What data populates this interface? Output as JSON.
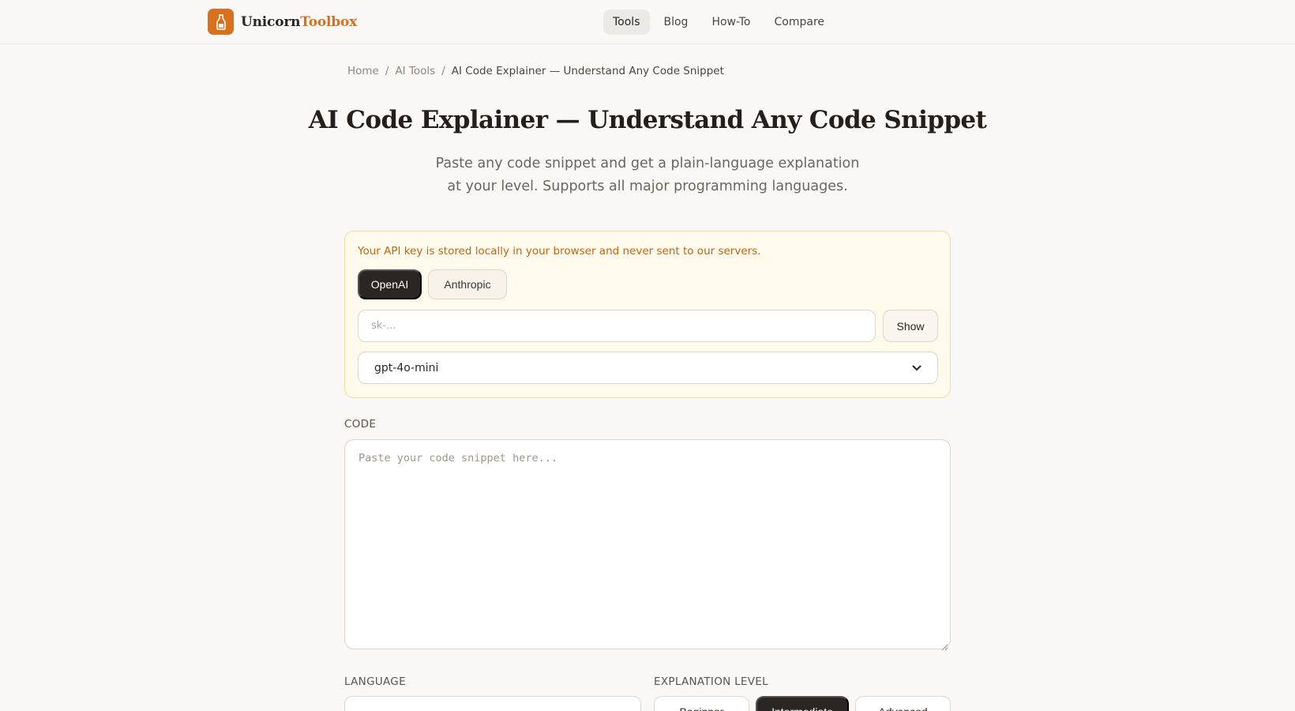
{
  "brand": {
    "name_part1": "Unicorn",
    "name_part2": "Toolbox",
    "accent": "#d9701c"
  },
  "nav": {
    "items": [
      {
        "label": "Tools",
        "active": true
      },
      {
        "label": "Blog"
      },
      {
        "label": "How-To"
      },
      {
        "label": "Compare"
      }
    ]
  },
  "breadcrumb": {
    "home": "Home",
    "section": "AI Tools",
    "current": "AI Code Explainer — Understand Any Code Snippet",
    "sep": "/"
  },
  "page": {
    "title": "AI Code Explainer — Understand Any Code Snippet",
    "subtitle_line1": "Paste any code snippet and get a plain-language explanation",
    "subtitle_line2": "at your level. Supports all major programming languages."
  },
  "api": {
    "note": "Your API key is stored locally in your browser and never sent to our servers.",
    "providers": [
      "OpenAI",
      "Anthropic"
    ],
    "selected_provider": "OpenAI",
    "key_placeholder": "sk-...",
    "show_label": "Show",
    "model": "gpt-4o-mini"
  },
  "code": {
    "label": "CODE",
    "placeholder": "Paste your code snippet here..."
  },
  "language": {
    "label": "LANGUAGE",
    "value": ""
  },
  "level": {
    "label": "EXPLANATION LEVEL",
    "options": [
      "Beginner",
      "Intermediate",
      "Advanced"
    ],
    "selected": "Intermediate"
  }
}
